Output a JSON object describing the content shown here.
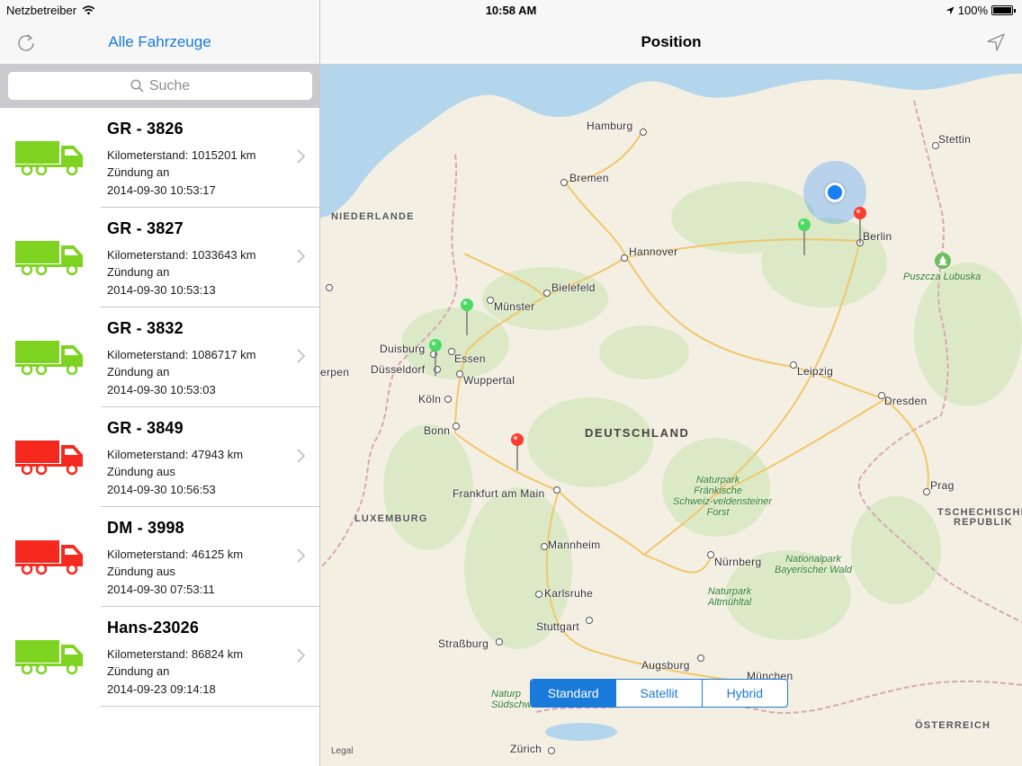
{
  "status_bar": {
    "carrier": "Netzbetreiber",
    "time": "10:58 AM",
    "battery": "100%",
    "battery_level": 1.0
  },
  "master": {
    "title": "Alle Fahrzeuge",
    "refresh_icon": "refresh-icon",
    "search": {
      "placeholder": "Suche",
      "icon": "search-icon"
    }
  },
  "vehicles": [
    {
      "name": "GR - 3826",
      "mileage": "Kilometerstand: 1015201 km",
      "ignition": "Zündung an",
      "timestamp": "2014-09-30 10:53:17",
      "color": "#7ed321"
    },
    {
      "name": "GR - 3827",
      "mileage": "Kilometerstand: 1033643 km",
      "ignition": "Zündung an",
      "timestamp": "2014-09-30 10:53:13",
      "color": "#7ed321"
    },
    {
      "name": "GR - 3832",
      "mileage": "Kilometerstand: 1086717 km",
      "ignition": "Zündung an",
      "timestamp": "2014-09-30 10:53:03",
      "color": "#7ed321"
    },
    {
      "name": "GR - 3849",
      "mileage": "Kilometerstand: 47943 km",
      "ignition": "Zündung aus",
      "timestamp": "2014-09-30 10:56:53",
      "color": "#f5291e"
    },
    {
      "name": "DM - 3998",
      "mileage": "Kilometerstand: 46125 km",
      "ignition": "Zündung aus",
      "timestamp": "2014-09-30 07:53:11",
      "color": "#f5291e"
    },
    {
      "name": "Hans-23026",
      "mileage": "Kilometerstand: 86824 km",
      "ignition": "Zündung an",
      "timestamp": "2014-09-23 09:14:18",
      "color": "#7ed321"
    }
  ],
  "detail": {
    "title": "Position",
    "locate_icon": "location-arrow-icon"
  },
  "map": {
    "cities": {
      "hamburg": "Hamburg",
      "bremen": "Bremen",
      "hannover": "Hannover",
      "berlin": "Berlin",
      "stettin": "Stettin",
      "bielefeld": "Bielefeld",
      "muenster": "Münster",
      "duisburg": "Duisburg",
      "essen": "Essen",
      "duesseldorf": "Düsseldorf",
      "wuppertal": "Wuppertal",
      "koeln": "Köln",
      "bonn": "Bonn",
      "leipzig": "Leipzig",
      "dresden": "Dresden",
      "frankfurt": "Frankfurt am Main",
      "prag": "Prag",
      "mannheim": "Mannheim",
      "nuernberg": "Nürnberg",
      "karlsruhe": "Karlsruhe",
      "stuttgart": "Stuttgart",
      "strassburg": "Straßburg",
      "augsburg": "Augsburg",
      "muenchen": "München",
      "zuerich": "Zürich",
      "erpen": "erpen"
    },
    "regions": {
      "niederlande": "NIEDERLANDE",
      "deutschland": "DEUTSCHLAND",
      "luxemburg": "LUXEMBURG",
      "tschechische": "TSCHECHISCHE",
      "republik": "REPUBLIK",
      "oesterreich": "ÖSTERREICH"
    },
    "parks": {
      "puszcza": "Puszcza Lubuska",
      "frankische_1": "Naturpark",
      "frankische_2": "Fränkische",
      "frankische_3": "Schweiz-veldensteiner",
      "frankische_4": "Forst",
      "bayerischer_1": "Nationalpark",
      "bayerischer_2": "Bayerischer Wald",
      "altmuehl_1": "Naturpark",
      "altmuehl_2": "Altmühltal",
      "sued_1": "Naturp",
      "sued_2": "Südschwa"
    },
    "pins": [
      {
        "color": "#4cd964",
        "label": "green-pin"
      },
      {
        "color": "#ff3b30",
        "label": "red-pin"
      },
      {
        "color": "#4cd964",
        "label": "green-pin"
      },
      {
        "color": "#4cd964",
        "label": "green-pin"
      },
      {
        "color": "#ff3b30",
        "label": "red-pin"
      }
    ],
    "map_types": [
      "Standard",
      "Satellit",
      "Hybrid"
    ],
    "selected_map_type": "Standard",
    "legal": "Legal"
  }
}
